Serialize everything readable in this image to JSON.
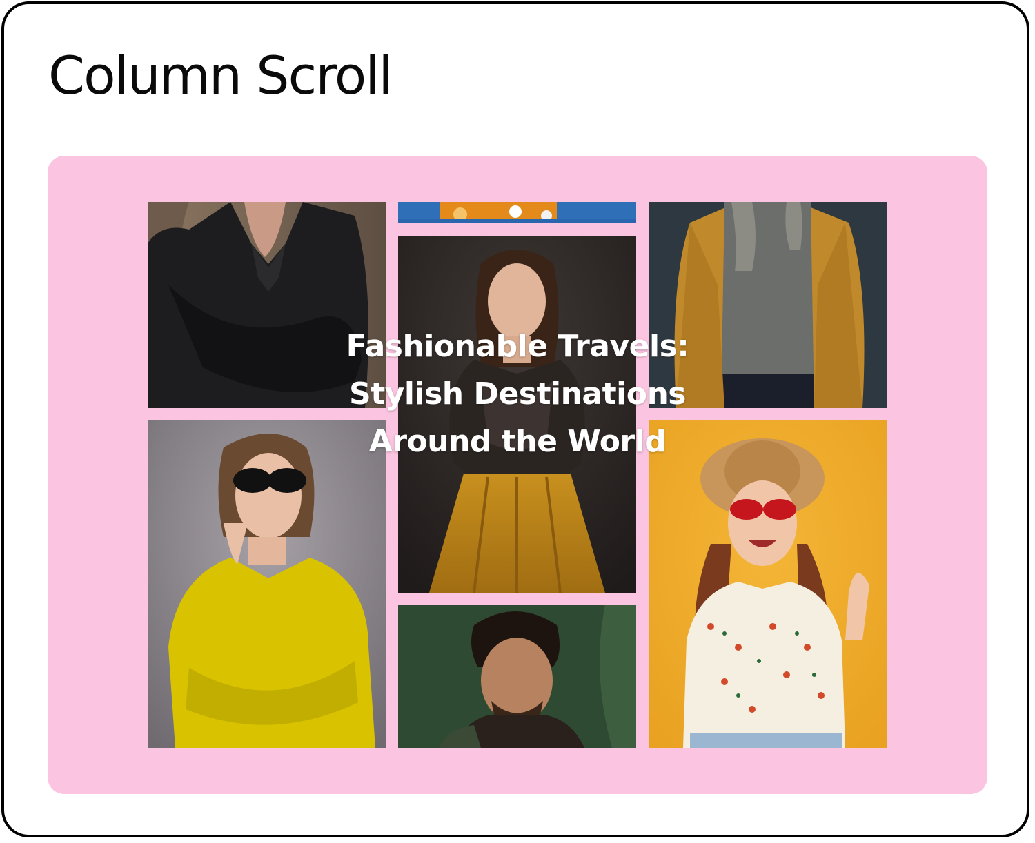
{
  "page": {
    "title": "Column Scroll"
  },
  "gallery": {
    "headline": "Fashionable Travels: Stylish Destinations Around the World",
    "background_color": "#fbc4e0",
    "photos": [
      {
        "name": "photo-woman-black-trench-coat",
        "column": 1,
        "order": 1
      },
      {
        "name": "photo-woman-yellow-coat-sunglasses",
        "column": 1,
        "order": 2
      },
      {
        "name": "photo-colorful-partial",
        "column": 2,
        "order": 1
      },
      {
        "name": "photo-woman-brown-blouse-mustard-skirt",
        "column": 2,
        "order": 2
      },
      {
        "name": "photo-man-curly-hair-green-backdrop",
        "column": 2,
        "order": 3
      },
      {
        "name": "photo-man-mustard-jacket-grey-sweater",
        "column": 3,
        "order": 1
      },
      {
        "name": "photo-woman-straw-hat-red-sunglasses",
        "column": 3,
        "order": 2
      }
    ]
  }
}
